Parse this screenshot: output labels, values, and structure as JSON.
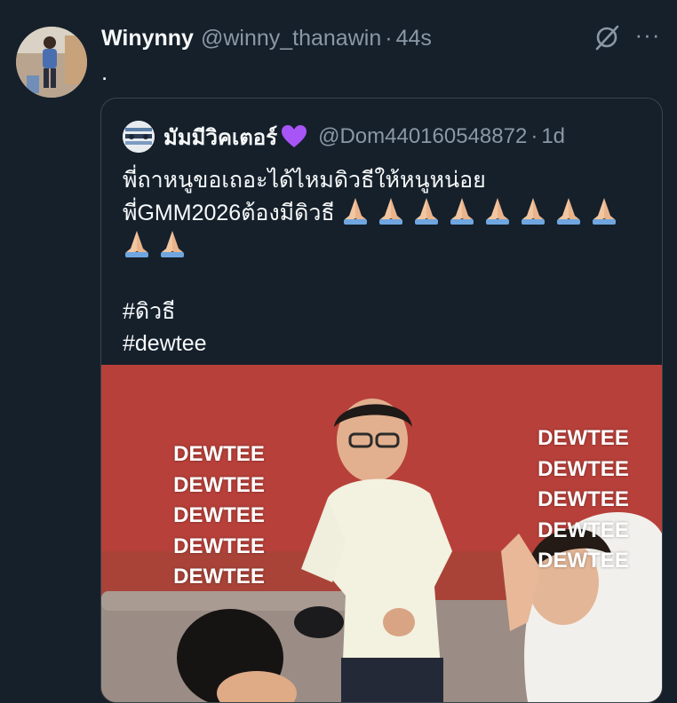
{
  "tweet": {
    "author_name": "Winynny",
    "handle": "@winny_thanawin",
    "separator": "·",
    "time": "44s",
    "text": "."
  },
  "icons": {
    "grok": "grok-icon",
    "more": "more-icon",
    "more_glyph": "···"
  },
  "quote": {
    "author_name": "มัมมีวิคเตอร์",
    "author_emoji": "purple-heart",
    "handle": "@Dom440160548872",
    "separator": "·",
    "time": "1d",
    "line1": "พี่ถาหนูขอเถอะได้ไหมดิวธีให้หนูหน่อย",
    "line2": "พี่GMM2026ต้องมีดิวธี",
    "pray_count_line2": 8,
    "pray_count_line3": 2,
    "hashtag1": "#ดิวธี",
    "hashtag2": "#dewtee"
  },
  "photo": {
    "left_text": [
      "DEWTEE",
      "DEWTEE",
      "DEWTEE",
      "DEWTEE",
      "DEWTEE"
    ],
    "right_text": [
      "DEWTEE",
      "DEWTEE",
      "DEWTEE",
      "DEWTEE",
      "DEWTEE"
    ]
  },
  "colors": {
    "background": "#15202b",
    "secondary_text": "#8b98a5",
    "border": "#38444d",
    "photo_wall": "#b23a33"
  }
}
